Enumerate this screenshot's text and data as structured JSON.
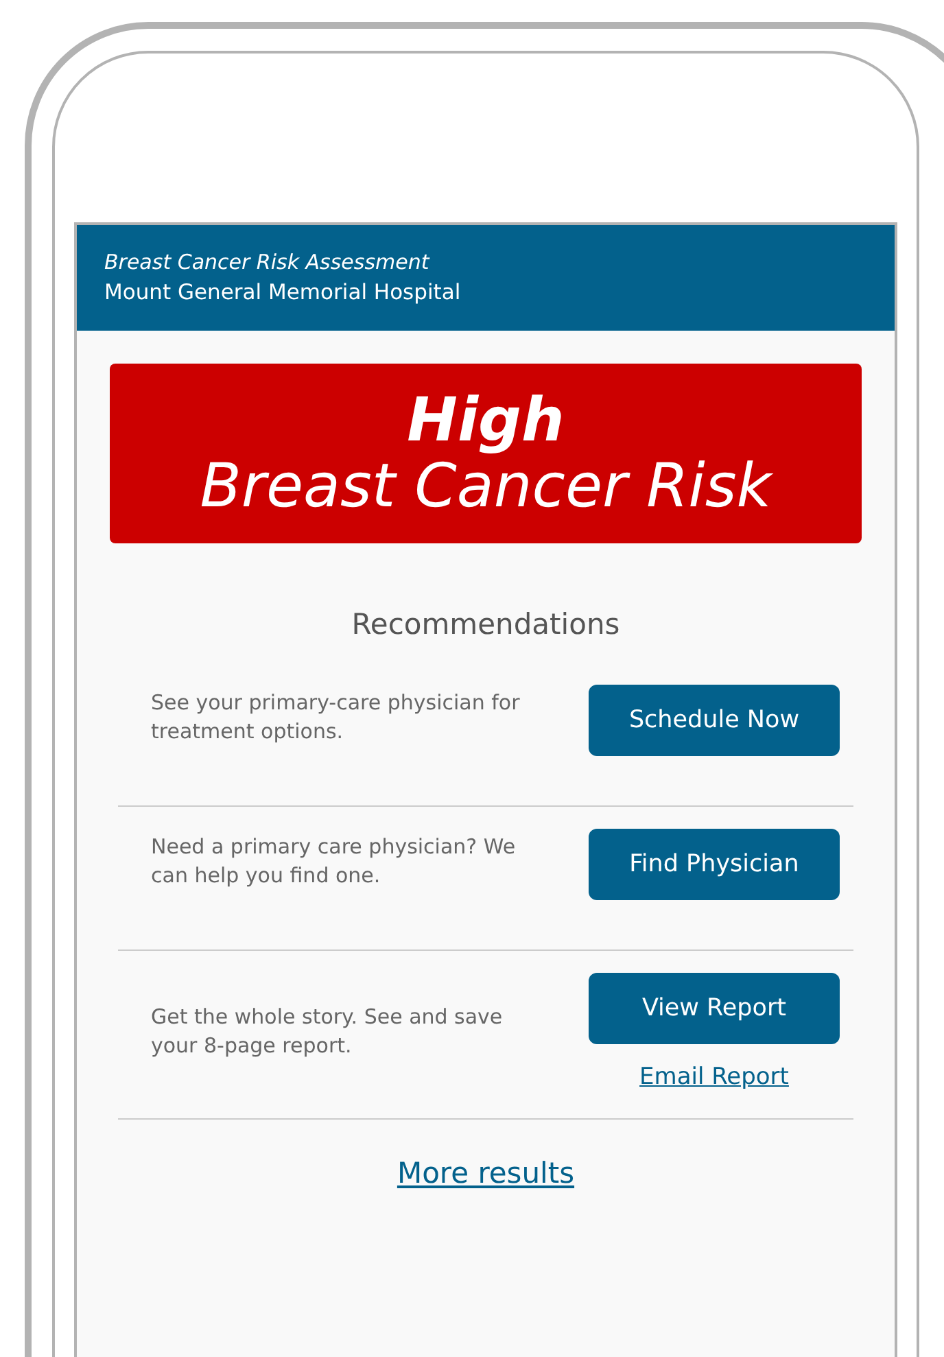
{
  "header": {
    "app_title": "Breast Cancer Risk Assessment",
    "hospital": "Mount General Memorial Hospital"
  },
  "risk": {
    "level": "High",
    "label": "Breast Cancer Risk"
  },
  "recommendations": {
    "title": "Recommendations",
    "items": [
      {
        "text": "See your primary-care physician for treatment options.",
        "button": "Schedule Now"
      },
      {
        "text": "Need a primary care physician? We can help you find one.",
        "button": "Find Physician"
      },
      {
        "text": "Get the whole story. See and save your 8-page report.",
        "button": "View Report",
        "link": "Email Report"
      }
    ]
  },
  "more_link": "More results"
}
